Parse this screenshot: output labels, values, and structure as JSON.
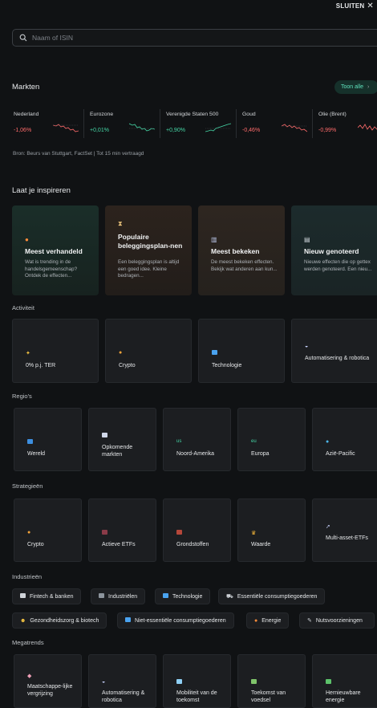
{
  "header": {
    "close_label": "SLUITEN",
    "close_icon": "close-icon"
  },
  "search": {
    "placeholder": "Naam of ISIN",
    "icon": "search-icon"
  },
  "markets": {
    "title": "Markten",
    "show_all": "Toon alle",
    "items": [
      {
        "name": "Nederland",
        "change": "-1,06%",
        "direction": "down"
      },
      {
        "name": "Eurozone",
        "change": "+0,01%",
        "direction": "up"
      },
      {
        "name": "Verenigde Staten 500",
        "change": "+0,90%",
        "direction": "up"
      },
      {
        "name": "Goud",
        "change": "-0,46%",
        "direction": "down"
      },
      {
        "name": "Olie (Brent)",
        "change": "-0,99%",
        "direction": "down"
      }
    ],
    "source": "Bron: Beurs van Stuttgart, FactSet | Tot 15 min vertraagd"
  },
  "inspire": {
    "title": "Laat je inspireren",
    "cards": [
      {
        "icon": "fire-icon",
        "title": "Meest verhandeld",
        "desc": "Wat is trending in de handelsgemeenschap? Ontdek de effecten..."
      },
      {
        "icon": "hourglass-icon",
        "title": "Populaire beleggingsplan-nen",
        "desc": "Een beleggingsplan is altijd een goed idee. Kleine bedragen..."
      },
      {
        "icon": "chart-icon",
        "title": "Meest bekeken",
        "desc": "De meest bekeken effecten. Bekijk wat anderen aan kun..."
      },
      {
        "icon": "newspaper-icon",
        "title": "Nieuw genoteerd",
        "desc": "Nieuwe effecten die op gettex werden genoteerd. Een nieu..."
      }
    ]
  },
  "activity": {
    "title": "Activiteit",
    "items": [
      {
        "icon": "sparkle-icon",
        "label": "0% p.j. TER"
      },
      {
        "icon": "coin-icon",
        "label": "Crypto"
      },
      {
        "icon": "monitor-icon",
        "label": "Technologie"
      },
      {
        "icon": "robot-icon",
        "label": "Automatisering & robotica"
      }
    ]
  },
  "regions": {
    "title": "Regio's",
    "items": [
      {
        "icon": "world-map-icon",
        "label": "Wereld"
      },
      {
        "icon": "rising-chart-icon",
        "label": "Opkomende markten"
      },
      {
        "icon": "us-flag-icon",
        "label": "Noord-Amerika"
      },
      {
        "icon": "eu-flag-icon",
        "label": "Europa"
      },
      {
        "icon": "globe-asia-icon",
        "label": "Azië-Pacific"
      }
    ]
  },
  "strategies": {
    "title": "Strategieën",
    "items": [
      {
        "icon": "coin-icon",
        "label": "Crypto"
      },
      {
        "icon": "joystick-icon",
        "label": "Actieve ETFs"
      },
      {
        "icon": "barrel-icon",
        "label": "Grondstoffen"
      },
      {
        "icon": "crown-icon",
        "label": "Waarde"
      },
      {
        "icon": "rocket-icon",
        "label": "Multi-asset-ETFs"
      }
    ]
  },
  "industries": {
    "title": "Industrieën",
    "row1": [
      {
        "icon": "bank-icon",
        "label": "Fintech & banken"
      },
      {
        "icon": "factory-icon",
        "label": "Industriëlen"
      },
      {
        "icon": "monitor-icon",
        "label": "Technologie"
      },
      {
        "icon": "cart-icon",
        "label": "Essentiële consumptiegoederen"
      }
    ],
    "row2": [
      {
        "icon": "face-icon",
        "label": "Gezondheidszorg & biotech"
      },
      {
        "icon": "shopping-bags-icon",
        "label": "Niet-essentiële consumptiegoederen"
      },
      {
        "icon": "fire-icon",
        "label": "Energie"
      },
      {
        "icon": "wrench-icon",
        "label": "Nutsvoorzieningen"
      }
    ]
  },
  "megatrends": {
    "title": "Megatrends",
    "items": [
      {
        "icon": "tag-icon",
        "label": "Maatschappe-lijke vergrijzing"
      },
      {
        "icon": "robot-icon",
        "label": "Automatisering & robotica"
      },
      {
        "icon": "car-icon",
        "label": "Mobiliteit van de toekomst"
      },
      {
        "icon": "food-icon",
        "label": "Toekomst van voedsel"
      },
      {
        "icon": "battery-icon",
        "label": "Hernieuwbare energie"
      }
    ]
  },
  "colors": {
    "background": "#101214",
    "accent": "#5fe3bd",
    "negative": "#ff6b6b",
    "positive": "#45d6a6"
  }
}
